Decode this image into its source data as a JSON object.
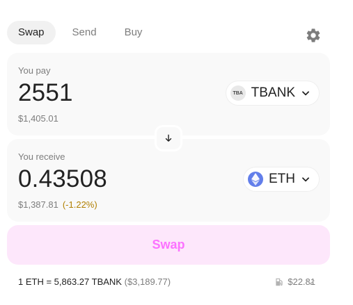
{
  "tabs": [
    {
      "label": "Swap",
      "active": true
    },
    {
      "label": "Send",
      "active": false
    },
    {
      "label": "Buy",
      "active": false
    }
  ],
  "icons": {
    "settings": "gear-icon",
    "switch": "arrow-down-icon",
    "dropdown": "chevron-down-icon",
    "gas": "gas-pump-icon"
  },
  "pay": {
    "label": "You pay",
    "amount": "2551",
    "usd": "$1,405.01",
    "token": {
      "symbol": "TBANK",
      "logo_text": "TBA"
    }
  },
  "receive": {
    "label": "You receive",
    "amount": "0.43508",
    "usd": "$1,387.81",
    "price_impact": "(-1.22%)",
    "token": {
      "symbol": "ETH"
    }
  },
  "swap_button": {
    "label": "Swap"
  },
  "footer": {
    "rate": "1 ETH = 5,863.27 TBANK",
    "rate_usd": "($3,189.77)",
    "gas_fee": "$22.81"
  },
  "colors": {
    "accent": "#fc72ff",
    "accent_bg": "#fde7fb",
    "panel_bg": "#f9f9f9",
    "muted_text": "#7d7d7d",
    "warning": "#b07f00",
    "eth_blue": "#627eea"
  }
}
